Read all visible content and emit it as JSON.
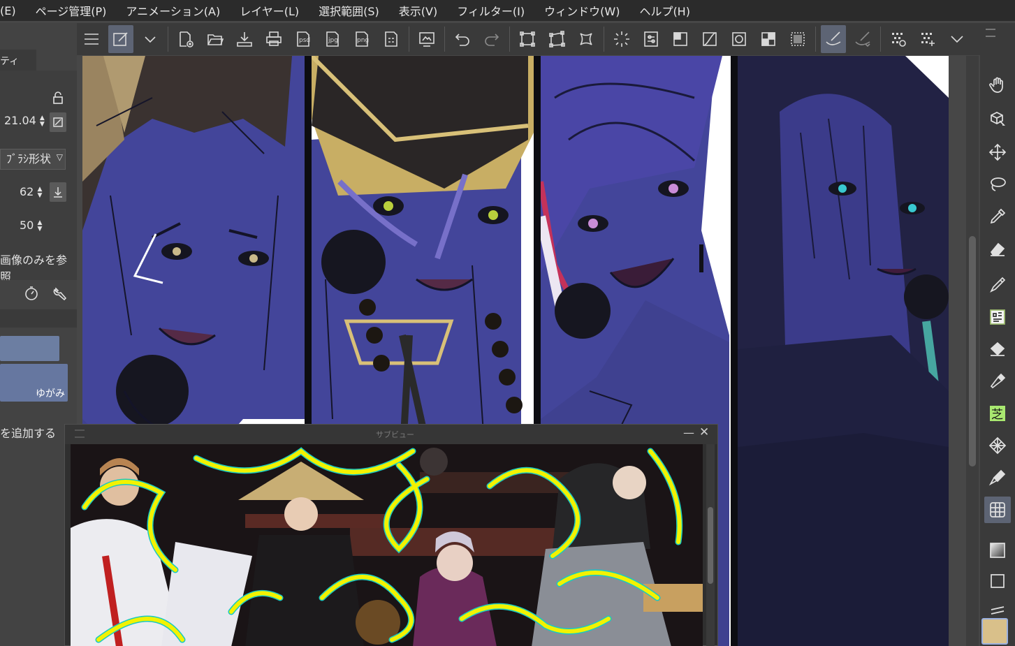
{
  "menu": {
    "items": [
      "(E)",
      "ページ管理(P)",
      "アニメーション(A)",
      "レイヤー(L)",
      "選択範囲(S)",
      "表示(V)",
      "フィルター(I)",
      "ウィンドウ(W)",
      "ヘルプ(H)"
    ]
  },
  "toolbar": {
    "labels": {
      "psd": "psd",
      "jpg": "jpg",
      "png": "png"
    }
  },
  "left_panel": {
    "tab_label": "ティ",
    "brush_size": "21.04",
    "brush_pattern": " ﾌﾞﾗｼ形状",
    "opacity": "62",
    "density": "50",
    "ref_label": "画像のみを参照",
    "distort_label": "ゆがみ",
    "add_label": "を追加する"
  },
  "subview": {
    "title": "サブビュー",
    "minimize": "—",
    "close": "✕"
  },
  "colors": {
    "accent_active": "#5d6474",
    "main_color": "#d9c08a",
    "swatch_blue": "#6c7ea2",
    "lineart_yellow": "#f2f200",
    "lineart_cyan": "#19c9c0"
  },
  "icons": {
    "right_tools": [
      "hand-icon",
      "object-icon",
      "move-icon",
      "lasso-icon",
      "eyedropper-icon",
      "eraser-icon",
      "pen-icon",
      "custom-brush-icon",
      "fill-icon",
      "airbrush-icon",
      "shiba-icon",
      "pattern-icon",
      "marker-icon",
      "frame-icon",
      "gradient-icon",
      "rectangle-icon",
      "text-icon"
    ]
  }
}
